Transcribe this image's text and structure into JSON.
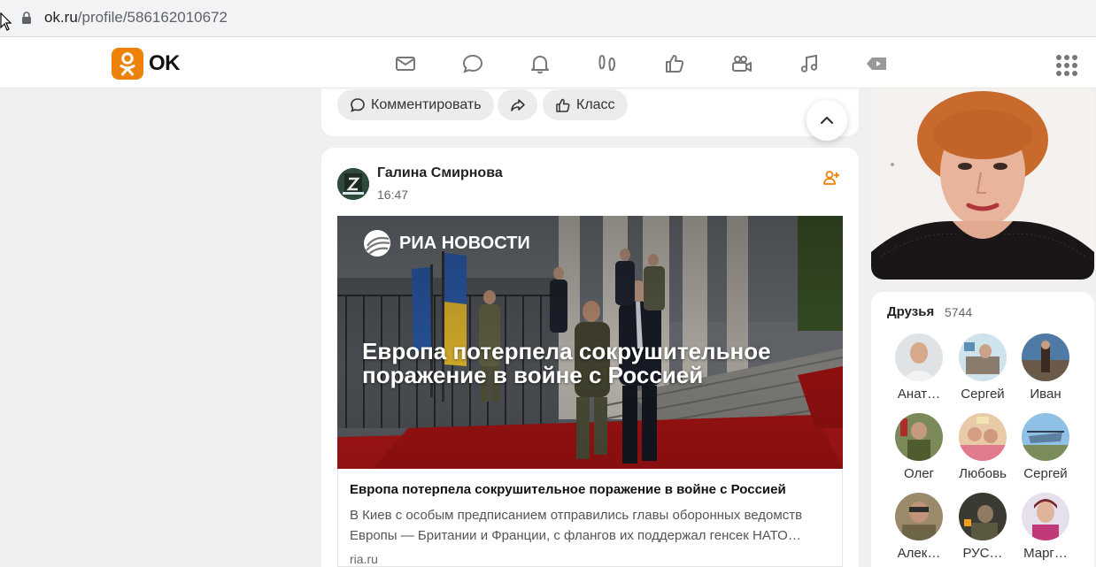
{
  "browser": {
    "url_host": "ok.ru",
    "url_path": "/profile/586162010672"
  },
  "topnav": {
    "logo_text": "OK",
    "icons": [
      "mail-icon",
      "chat-icon",
      "bell-icon",
      "guests-icon",
      "like-icon",
      "video-camera-icon",
      "music-icon",
      "video-icon"
    ]
  },
  "prev_post_actions": {
    "comment": "Комментировать",
    "like": "Класс"
  },
  "post": {
    "author": "Галина Смирнова",
    "time": "16:47",
    "media_brand": "РИА НОВОСТИ",
    "media_headline": "Европа потерпела сокрушительное поражение в войне с Россией",
    "link_title": "Европа потерпела сокрушительное поражение в войне с Россией",
    "link_description": "В Киев с особым предписанием отправились главы оборонных ведомств Европы — Британии и Франции, с флангов их поддержал генсек НАТО…",
    "link_domain": "ria.ru"
  },
  "friends": {
    "title": "Друзья",
    "count": "5744",
    "items": [
      {
        "name": "Анат…"
      },
      {
        "name": "Сергей"
      },
      {
        "name": "Иван"
      },
      {
        "name": "Олег"
      },
      {
        "name": "Любовь"
      },
      {
        "name": "Сергей"
      },
      {
        "name": "Алек…"
      },
      {
        "name": "РУС…"
      },
      {
        "name": "Марг…"
      }
    ]
  },
  "colors": {
    "brand_orange": "#ee8208",
    "background": "#f0f0f0"
  }
}
